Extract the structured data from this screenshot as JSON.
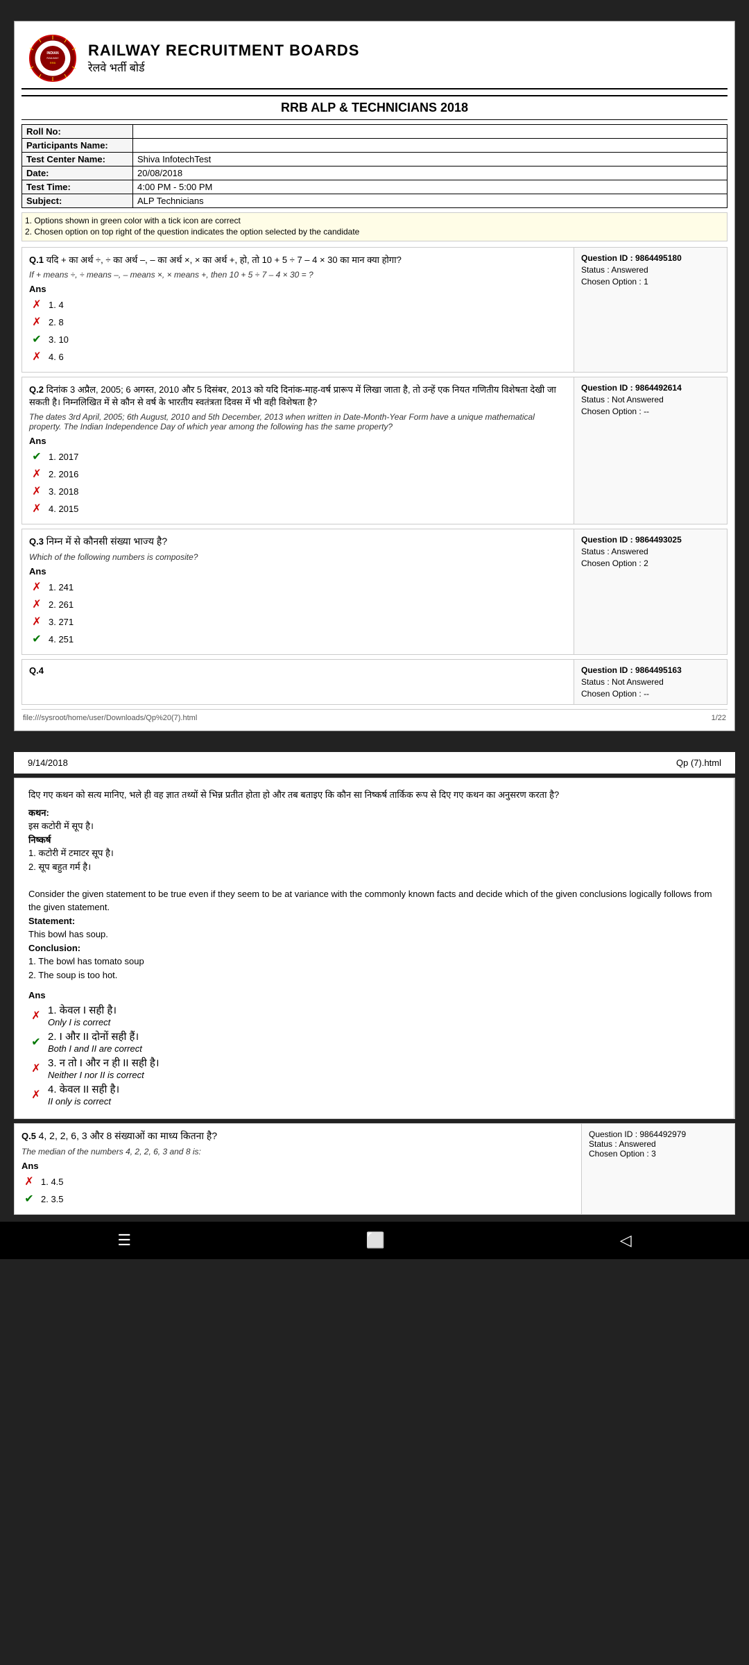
{
  "header": {
    "title": "RAILWAY RECRUITMENT BOARDS",
    "subtitle": "रेलवे भर्ती बोर्ड"
  },
  "exam": {
    "title": "RRB ALP & TECHNICIANS 2018"
  },
  "info": {
    "roll_no_label": "Roll No:",
    "roll_no_value": "",
    "participants_label": "Participants Name:",
    "participants_value": "",
    "center_label": "Test Center Name:",
    "center_value": "Shiva InfotechTest",
    "date_label": "Date:",
    "date_value": "20/08/2018",
    "time_label": "Test Time:",
    "time_value": "4:00 PM - 5:00 PM",
    "subject_label": "Subject:",
    "subject_value": "ALP Technicians"
  },
  "notes": {
    "note1": "1. Options shown in green color with a tick icon are correct",
    "note2": "2. Chosen option on top right of the question indicates the option selected by the candidate"
  },
  "questions": [
    {
      "id": "Q.1",
      "text_hindi": "यदि + का अर्थ ÷, ÷ का अर्थ –, – का अर्थ ×, × का अर्थ +, हो, तो 10 + 5 ÷ 7 – 4 × 30 का मान क्या होगा?",
      "text_english": "If + means ÷, ÷ means –, – means ×, × means +, then 10 + 5 ÷ 7 – 4 × 30 = ?",
      "question_id": "9864495180",
      "status": "Answered",
      "chosen_option": "1",
      "answers": [
        {
          "num": "1",
          "text": "4",
          "type": "cross"
        },
        {
          "num": "2",
          "text": "8",
          "type": "cross"
        },
        {
          "num": "3",
          "text": "10",
          "type": "tick"
        },
        {
          "num": "4",
          "text": "6",
          "type": "cross"
        }
      ]
    },
    {
      "id": "Q.2",
      "text_hindi": "दिनांक 3 अप्रैल, 2005; 6 अगस्त, 2010 और 5 दिसंबर, 2013 को यदि दिनांक-माह-वर्ष प्रारूप में लिखा जाता है, तो उन्हें एक नियत गणितीय विशेषता देखी जा सकती है। निम्नलिखित में से कौन से वर्ष के भारतीय स्वतंत्रता दिवस में भी वही विशेषता है?",
      "text_english": "The dates 3rd April, 2005; 6th August, 2010 and 5th December, 2013 when written in Date-Month-Year Form have a unique mathematical property. The Indian Independence Day of which year among the following has the same property?",
      "question_id": "9864492614",
      "status": "Not Answered",
      "chosen_option": "--",
      "answers": [
        {
          "num": "1",
          "text": "2017",
          "type": "tick"
        },
        {
          "num": "2",
          "text": "2016",
          "type": "cross"
        },
        {
          "num": "3",
          "text": "2018",
          "type": "cross"
        },
        {
          "num": "4",
          "text": "2015",
          "type": "cross"
        }
      ]
    },
    {
      "id": "Q.3",
      "text_hindi": "निम्न में से कौनसी संख्या भाज्य है?",
      "text_english": "Which of the following numbers is composite?",
      "question_id": "9864493025",
      "status": "Answered",
      "chosen_option": "2",
      "answers": [
        {
          "num": "1",
          "text": "241",
          "type": "cross"
        },
        {
          "num": "2",
          "text": "261",
          "type": "cross"
        },
        {
          "num": "3",
          "text": "271",
          "type": "cross"
        },
        {
          "num": "4",
          "text": "251",
          "type": "tick"
        }
      ]
    },
    {
      "id": "Q.4",
      "text_hindi": "",
      "text_english": "",
      "question_id": "9864495163",
      "status": "Not Answered",
      "chosen_option": "--",
      "answers": []
    }
  ],
  "footer": {
    "file_path": "file:///sysroot/home/user/Downloads/Qp%20(7).html",
    "page": "1/22"
  },
  "page2": {
    "date": "9/14/2018",
    "file": "Qp (7).html"
  },
  "q4_full": {
    "id": "Q.4",
    "statement_hindi": "दिए गए कथन को सत्य मानिए, भले ही वह ज्ञात तथ्यों से भिन्न प्रतीत होता हो और तब बताइए कि कौन सा निष्कर्ष तार्किक रूप से दिए गए कथन का अनुसरण करता है?",
    "kathan_label": "कथन:",
    "kathan_text": "इस कटोरी में सूप है।",
    "nishkarsh_label": "निष्कर्ष",
    "nishkarsh_items": [
      "1. कटोरी में टमाटर सूप है।",
      "2. सूप बहुत गर्म है।"
    ],
    "statement_english": "Consider the given statement to be true even if they seem to be at variance with the commonly known facts and decide which of the given conclusions logically follows from the given statement.",
    "statement_label": "Statement:",
    "statement_text": "This bowl has soup.",
    "conclusion_label": "Conclusion:",
    "conclusion_items": [
      "1. The bowl has tomato soup",
      "2. The soup is too hot."
    ],
    "answers": [
      {
        "num": "1",
        "text_hindi": "केवल I सही है।",
        "text_english": "Only I is correct",
        "type": "cross"
      },
      {
        "num": "2",
        "text_hindi": "I और II दोनों सही हैं।",
        "text_english": "Both I and II are correct",
        "type": "tick"
      },
      {
        "num": "3",
        "text_hindi": "न तो I और न ही II सही है।",
        "text_english": "Neither I nor II is correct",
        "type": "cross"
      },
      {
        "num": "4",
        "text_hindi": "केवल II सही है।",
        "text_english": "II only is correct",
        "type": "cross"
      }
    ]
  },
  "q5": {
    "id": "Q.5",
    "text_hindi": "4, 2, 2, 6, 3 और 8 संख्याओं का माध्य कितना है?",
    "text_english": "The median of the numbers 4, 2, 2, 6, 3 and 8 is:",
    "question_id": "9864492979",
    "status": "Answered",
    "chosen_option": "3",
    "answers": [
      {
        "num": "1",
        "text": "4.5",
        "type": "cross"
      },
      {
        "num": "2",
        "text": "3.5",
        "type": "tick"
      }
    ]
  },
  "nav": {
    "menu_icon": "☰",
    "home_icon": "⬜",
    "back_icon": "◁"
  }
}
